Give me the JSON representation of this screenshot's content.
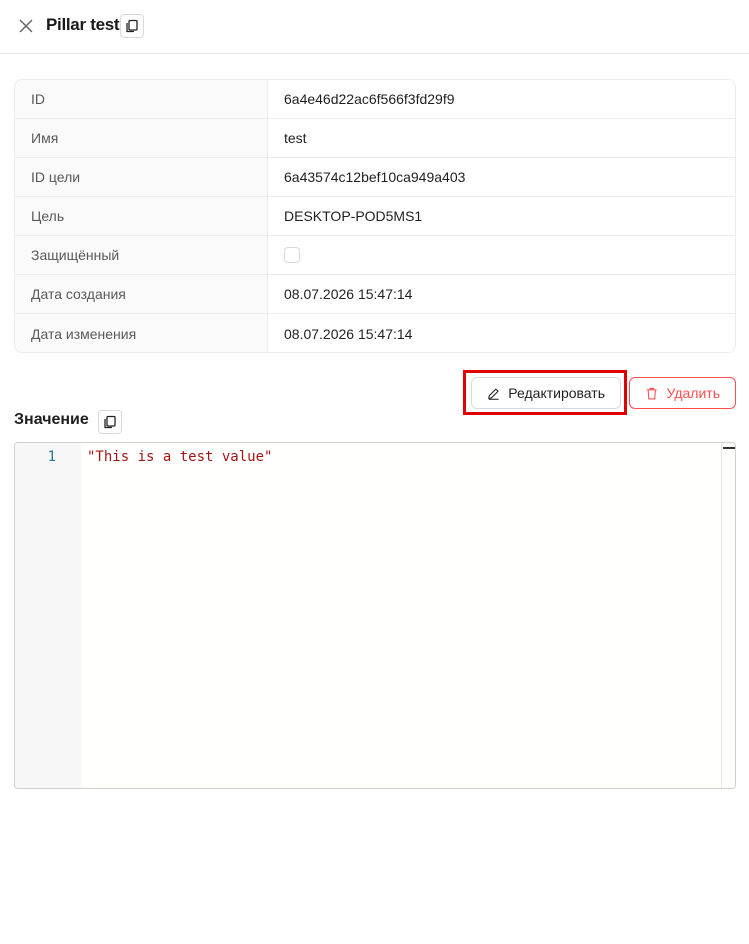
{
  "header": {
    "title": "Pillar test"
  },
  "details": {
    "rows": [
      {
        "label": "ID",
        "value": "6a4e46d22ac6f566f3fd29f9"
      },
      {
        "label": "Имя",
        "value": "test"
      },
      {
        "label": "ID цели",
        "value": "6a43574c12bef10ca949a403"
      },
      {
        "label": "Цель",
        "value": "DESKTOP-POD5MS1"
      },
      {
        "label": "Защищённый",
        "value": "",
        "checked": false
      },
      {
        "label": "Дата создания",
        "value": "08.07.2026 15:47:14"
      },
      {
        "label": "Дата изменения",
        "value": "08.07.2026 15:47:14"
      }
    ]
  },
  "actions": {
    "edit_label": "Редактировать",
    "delete_label": "Удалить"
  },
  "value_section": {
    "title": "Значение",
    "line_number": "1",
    "code": "\"This is a test value\""
  },
  "colors": {
    "danger": "#ff4d4f",
    "highlight": "#e00000",
    "string": "#a31515",
    "line_number": "#237893"
  },
  "icons": {
    "close": "close-icon",
    "copy": "copy-icon",
    "edit": "edit-icon",
    "delete": "delete-icon"
  }
}
